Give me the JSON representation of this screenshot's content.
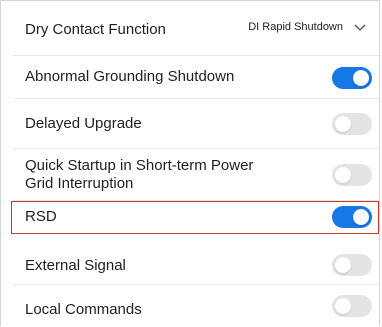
{
  "settings": {
    "dry_contact": {
      "label": "Dry Contact Function",
      "value": "DI Rapid Shutdown"
    },
    "items": [
      {
        "label": "Abnormal Grounding Shutdown",
        "enabled": true
      },
      {
        "label": "Delayed Upgrade",
        "enabled": false
      },
      {
        "label": "Quick Startup in Short-term Power Grid Interruption",
        "enabled": false
      },
      {
        "label": "RSD",
        "enabled": true,
        "highlighted": true
      },
      {
        "label": "External Signal",
        "enabled": false
      },
      {
        "label": "Local Commands",
        "enabled": false
      }
    ]
  },
  "colors": {
    "toggle_on": "#1677e6",
    "toggle_off": "#e4e4e4",
    "highlight_border": "#c0392b"
  },
  "icons": {
    "dropdown": "chevron-down-icon"
  }
}
